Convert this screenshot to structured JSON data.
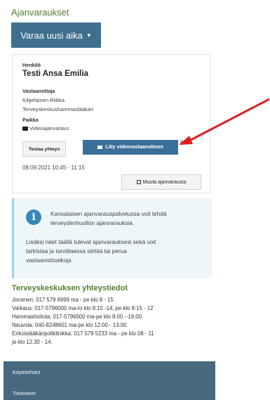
{
  "page": {
    "title": "Ajanvaraukset",
    "book_button": "Varaa uusi aika",
    "caret": "▼"
  },
  "appointment": {
    "person_label": "Henkilö",
    "person_name": "Testi Ansa Emilia",
    "provider_label": "Vastaanottaja",
    "provider_name": "Kilpeläinen Riikka",
    "provider_title": "Terveyskeskushammaslääkäri",
    "place_label": "Paikka",
    "place_value": "Videoajanvaraus",
    "test_button": "Testaa yhteys",
    "join_button": "Liity videovastaanottoon",
    "datetime": "08.09.2021 10:45 - 11:15",
    "change_button": "Muuta ajanvarausta",
    "partial_text": "ikka"
  },
  "info": {
    "icon": "info-icon",
    "line1": "Kansalaisen ajanvarauspalvelussa voit tehdä",
    "line2": "terveydenhuollon ajanvarauksia.",
    "line3": "Lisäksi näet täällä tulevat ajanvarauksesi sekä voit",
    "line4": "tarkistaa ja tarvittaessa siirtää tai perua",
    "line5": "vastaanottoaikoja"
  },
  "contacts": {
    "title": "Terveyskeskuksen yhteystiedot",
    "lines": [
      "Joroinen: 017 579 6999 ma - pe klo 8 - 15",
      "Varkaus: 017-5796000 ma-to klo 8:15 -14, pe klo 8:15 - 12",
      "Hammashoitola: 017-5796500 ma-pe klo 8:00 --16:00",
      "Neuvola: 040-8248601 ma-pe klo 12:00 - 13:00",
      "Erikoislääkäripoliklinikka: 017 579 5233 ma - pe klo 08 - 11",
      "ja klo 12.30 - 14."
    ]
  },
  "footer": {
    "link1": "Käyttöehdot",
    "link2": "Tiedotteet"
  },
  "colors": {
    "accent_green": "#4e7d2f",
    "button_blue": "#3f6f8f",
    "footer": "#46697f",
    "arrow_red": "#e02020"
  }
}
